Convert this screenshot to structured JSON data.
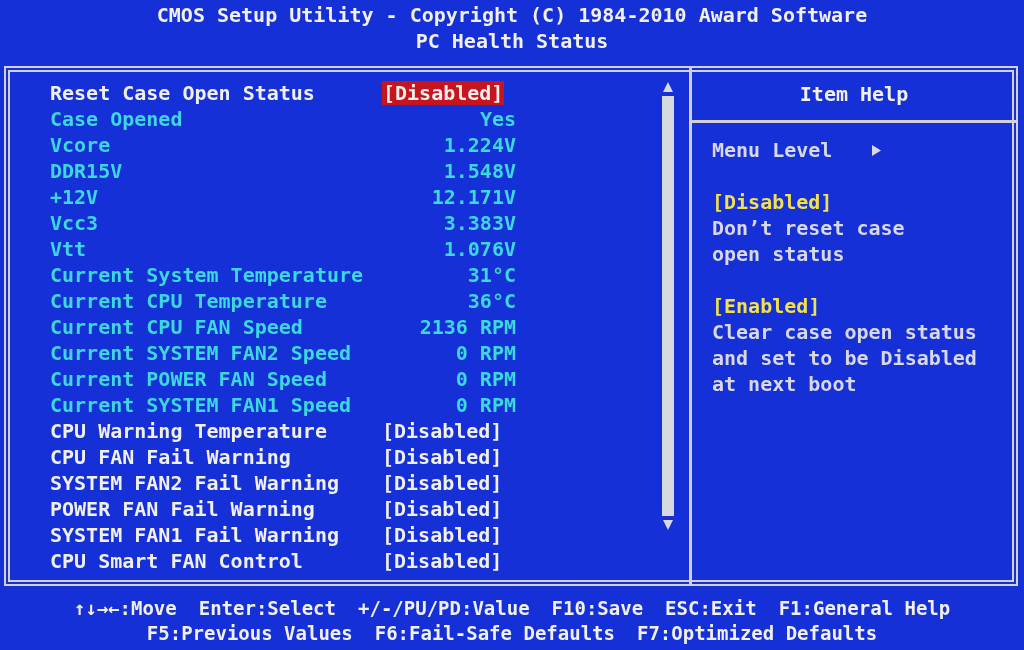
{
  "header": {
    "title": "CMOS Setup Utility - Copyright (C) 1984-2010 Award Software",
    "subtitle": "PC Health Status"
  },
  "items": [
    {
      "label": "Reset Case Open Status",
      "value": "[Disabled]",
      "kind": "setting",
      "selected": true
    },
    {
      "label": "Case Opened",
      "value": "Yes",
      "kind": "info",
      "selected": false
    },
    {
      "label": "Vcore",
      "value": "1.224V",
      "kind": "info",
      "selected": false
    },
    {
      "label": "DDR15V",
      "value": "1.548V",
      "kind": "info",
      "selected": false
    },
    {
      "label": "+12V",
      "value": "12.171V",
      "kind": "info",
      "selected": false
    },
    {
      "label": "Vcc3",
      "value": "3.383V",
      "kind": "info",
      "selected": false
    },
    {
      "label": "Vtt",
      "value": "1.076V",
      "kind": "info",
      "selected": false
    },
    {
      "label": "Current System Temperature",
      "value": "31°C",
      "kind": "info",
      "selected": false
    },
    {
      "label": "Current CPU Temperature",
      "value": "36°C",
      "kind": "info",
      "selected": false
    },
    {
      "label": "Current CPU FAN Speed",
      "value": "2136 RPM",
      "kind": "info",
      "selected": false
    },
    {
      "label": "Current SYSTEM FAN2 Speed",
      "value": "0 RPM",
      "kind": "info",
      "selected": false
    },
    {
      "label": "Current POWER FAN Speed",
      "value": "0 RPM",
      "kind": "info",
      "selected": false
    },
    {
      "label": "Current SYSTEM FAN1 Speed",
      "value": "0 RPM",
      "kind": "info",
      "selected": false
    },
    {
      "label": "CPU Warning Temperature",
      "value": "[Disabled]",
      "kind": "setting",
      "selected": false
    },
    {
      "label": "CPU FAN Fail Warning",
      "value": "[Disabled]",
      "kind": "setting",
      "selected": false
    },
    {
      "label": "SYSTEM FAN2 Fail Warning",
      "value": "[Disabled]",
      "kind": "setting",
      "selected": false
    },
    {
      "label": "POWER FAN Fail Warning",
      "value": "[Disabled]",
      "kind": "setting",
      "selected": false
    },
    {
      "label": "SYSTEM FAN1 Fail Warning",
      "value": "[Disabled]",
      "kind": "setting",
      "selected": false
    },
    {
      "label": "CPU Smart FAN Control",
      "value": "[Disabled]",
      "kind": "setting",
      "selected": false
    }
  ],
  "help": {
    "title": "Item Help",
    "menu_level": "Menu Level",
    "entries": [
      {
        "option": "[Disabled]",
        "lines": [
          "Don’t reset case",
          "open status"
        ]
      },
      {
        "option": "[Enabled]",
        "lines": [
          "Clear case open status",
          "and set to be Disabled",
          "at next boot"
        ]
      }
    ]
  },
  "footer": [
    [
      "↑↓→←:Move",
      "Enter:Select",
      "+/-/PU/PD:Value",
      "F10:Save",
      "ESC:Exit",
      "F1:General Help"
    ],
    [
      "F5:Previous Values",
      "F6:Fail-Safe Defaults",
      "F7:Optimized Defaults"
    ]
  ]
}
